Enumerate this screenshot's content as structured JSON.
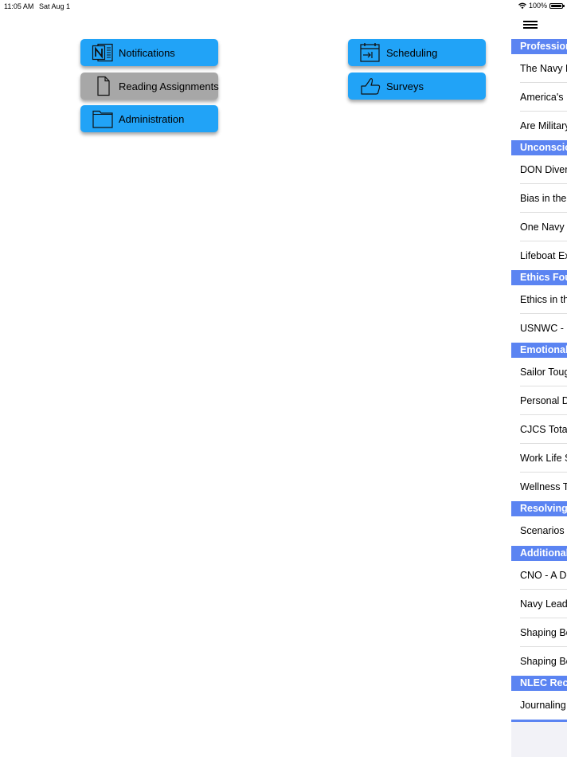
{
  "status_bar": {
    "time": "11:05 AM",
    "date": "Sat Aug 1",
    "battery": "100%"
  },
  "tiles": {
    "notifications": "Notifications",
    "reading_assignments": "Reading Assignments",
    "administration": "Administration",
    "scheduling": "Scheduling",
    "surveys": "Surveys"
  },
  "colors": {
    "tile_active": "#21a3f7",
    "tile_selected": "#a7a7a7",
    "section_header": "#5b84f2"
  },
  "side_menu": {
    "menu_icon": "hamburger-icon",
    "sections": [
      {
        "title": "Profession",
        "items": [
          "The Navy P",
          "America's N",
          "Are Military"
        ]
      },
      {
        "title": "Unconscio",
        "items": [
          "DON Divers",
          "Bias in the I",
          "One Navy T",
          "Lifeboat Ex"
        ]
      },
      {
        "title": "Ethics Four",
        "items": [
          "Ethics in th",
          "USNWC - E"
        ]
      },
      {
        "title": "Emotional",
        "items": [
          "Sailor Toug",
          "Personal De",
          "CJCS Total",
          "Work Life S",
          "Wellness Tr"
        ]
      },
      {
        "title": "Resolving",
        "items": [
          "Scenarios"
        ]
      },
      {
        "title": "Additional",
        "items": [
          "CNO - A De",
          "Navy Leade",
          "Shaping Be",
          "Shaping Be"
        ]
      },
      {
        "title": "NLEC Reco",
        "items": [
          "Journaling"
        ]
      }
    ]
  }
}
